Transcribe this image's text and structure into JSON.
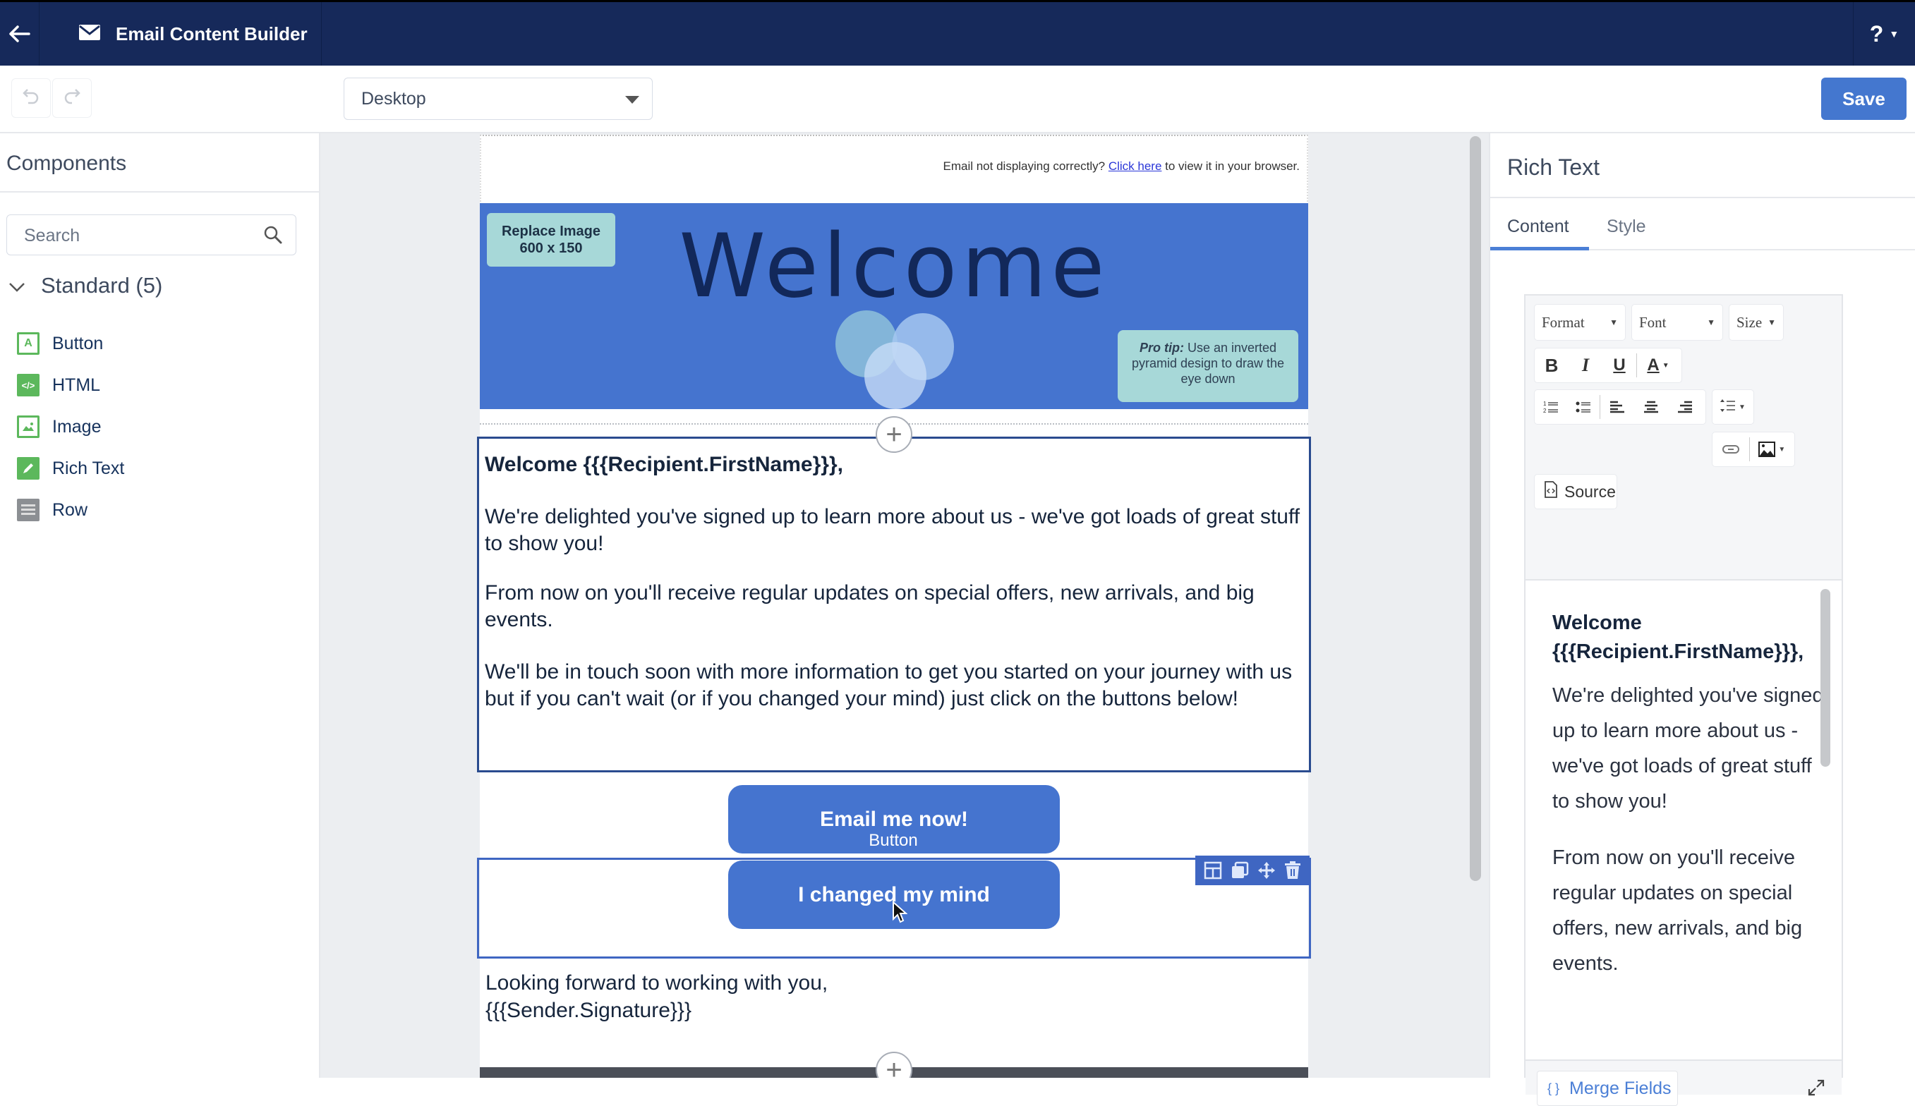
{
  "header": {
    "app_title": "Email Content Builder",
    "help_label": "?"
  },
  "toolbar": {
    "device_select": {
      "selected": "Desktop"
    },
    "save_label": "Save"
  },
  "left_panel": {
    "title": "Components",
    "search_placeholder": "Search",
    "section_label": "Standard (5)",
    "items": [
      {
        "label": "Button",
        "icon": "button-icon"
      },
      {
        "label": "HTML",
        "icon": "html-icon"
      },
      {
        "label": "Image",
        "icon": "image-icon"
      },
      {
        "label": "Rich Text",
        "icon": "rich-text-icon"
      },
      {
        "label": "Row",
        "icon": "row-icon"
      }
    ]
  },
  "email": {
    "preheader_prefix": "Email not displaying correctly? ",
    "preheader_link": "Click here",
    "preheader_suffix": " to view it in your browser.",
    "banner": {
      "replace_line1": "Replace Image",
      "replace_line2": "600 x 150",
      "headline": "Welcome",
      "protip_bold": "Pro tip:",
      "protip_text": " Use an inverted pyramid design to draw the eye down"
    },
    "body": {
      "greeting": "Welcome {{{Recipient.FirstName}}},",
      "para1": "We're delighted you've signed up to learn more about us - we've got loads of great stuff to show you!",
      "para2": "From now on you'll receive regular updates on special offers, new arrivals, and big events.",
      "para3": "We'll be in touch soon with more information to get you started on your journey with us but if you can't wait (or if you changed your mind) just click on the buttons below!"
    },
    "buttons": {
      "primary": "Email me now!",
      "secondary": "I changed my mind",
      "hover_tag": "Button"
    },
    "closing_line1": "Looking forward to working with you,",
    "closing_line2": "{{{Sender.Signature}}}"
  },
  "right_panel": {
    "title": "Rich Text",
    "tabs": [
      {
        "label": "Content",
        "active": true
      },
      {
        "label": "Style",
        "active": false
      }
    ],
    "editor": {
      "format_label": "Format",
      "font_label": "Font",
      "size_label": "Size",
      "source_label": "Source",
      "content": {
        "greeting": "Welcome {{{Recipient.FirstName}}},",
        "para1": "We're delighted you've signed up to learn more about us - we've got loads of great stuff to show you!",
        "para2": "From now on you'll receive regular updates on special offers, new arrivals, and big events."
      },
      "merge_fields_label": "Merge Fields"
    }
  },
  "colors": {
    "header_bg": "#16295a",
    "accent": "#4477cf",
    "banner": "#4574cf",
    "badge": "#a7d8d8",
    "component_green": "#5cb85c"
  }
}
